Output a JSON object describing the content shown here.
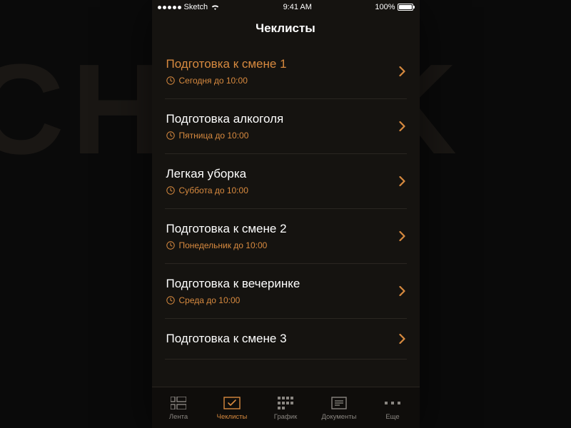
{
  "statusBar": {
    "carrier": "Sketch",
    "time": "9:41 AM",
    "batteryPct": "100%"
  },
  "nav": {
    "title": "Чеклисты"
  },
  "rows": [
    {
      "title": "Подготовка к смене 1",
      "due": "Сегодня до 10:00",
      "highlight": true
    },
    {
      "title": "Подготовка алкоголя",
      "due": "Пятница до 10:00",
      "highlight": false
    },
    {
      "title": "Легкая уборка",
      "due": "Суббота до 10:00",
      "highlight": false
    },
    {
      "title": "Подготовка к смене 2",
      "due": "Понедельник до 10:00",
      "highlight": false
    },
    {
      "title": "Подготовка к вечеринке",
      "due": "Среда до 10:00",
      "highlight": false
    },
    {
      "title": "Подготовка к смене 3",
      "due": "",
      "highlight": false
    }
  ],
  "tabs": [
    {
      "label": "Лента",
      "icon": "feed-icon"
    },
    {
      "label": "Чеклисты",
      "icon": "checklist-icon"
    },
    {
      "label": "График",
      "icon": "schedule-icon"
    },
    {
      "label": "Документы",
      "icon": "documents-icon"
    },
    {
      "label": "Еще",
      "icon": "more-icon"
    }
  ],
  "activeTab": 1,
  "colors": {
    "accent": "#d88a3f"
  }
}
